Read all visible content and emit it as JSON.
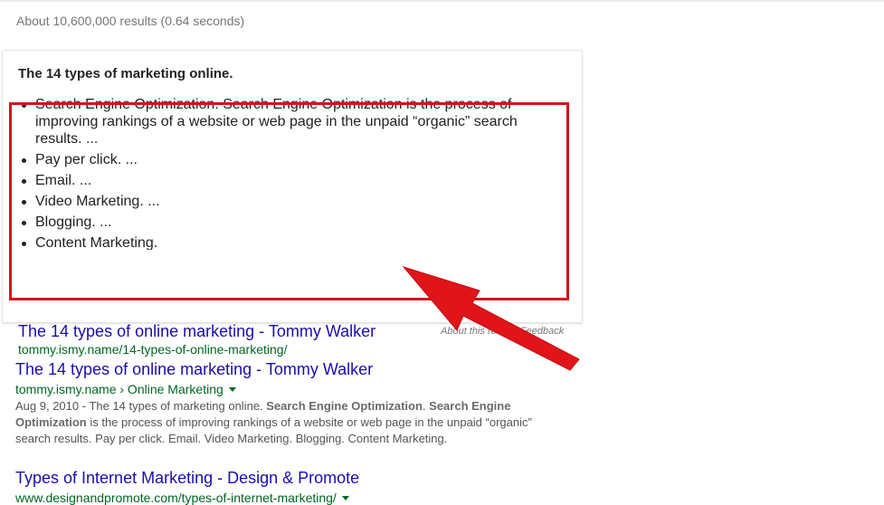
{
  "stats": "About 10,600,000 results (0.64 seconds)",
  "featured_snippet": {
    "heading": "The 14 types of marketing online.",
    "items": [
      "Search Engine Optimization. Search Engine Optimization is the process of improving rankings of a website or web page in the unpaid “organic” search results. ...",
      "Pay per click. ...",
      "Email. ...",
      "Video Marketing. ...",
      "Blogging. ...",
      "Content Marketing."
    ],
    "link_title": "The 14 types of online marketing - Tommy Walker",
    "link_url": "tommy.ismy.name/14-types-of-online-marketing/",
    "about_label": "About this result",
    "feedback_label": "Feedback"
  },
  "results": [
    {
      "title": "The 14 types of online marketing - Tommy Walker",
      "cite": "tommy.ismy.name › Online Marketing",
      "date": "Aug 9, 2010 - ",
      "desc_parts": [
        "The 14 types of marketing online. ",
        "Search Engine Optimization",
        ". ",
        "Search Engine Optimization",
        " is the process of improving rankings of a website or web page in the unpaid “organic” search results. Pay per click. Email. Video Marketing. Blogging. Content Marketing."
      ]
    },
    {
      "title": "Types of Internet Marketing - Design & Promote",
      "cite": "www.designandpromote.com/types-of-internet-marketing/"
    }
  ],
  "colors": {
    "link": "#1a0dab",
    "url": "#006621",
    "annotation_red": "#e01419",
    "highlight_border": "#d6131a"
  },
  "icons": [
    "caret-down-icon",
    "red-arrow-annotation"
  ]
}
